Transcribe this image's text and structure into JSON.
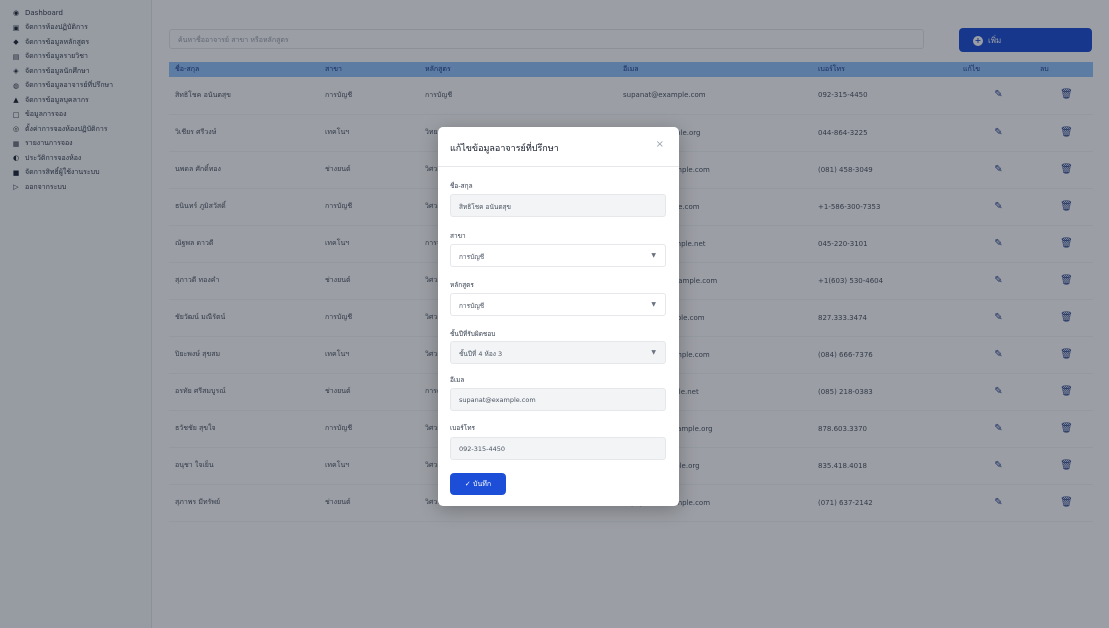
{
  "sidebar": {
    "items": [
      {
        "icon": "dashboard-icon",
        "glyph": "◉",
        "label": "Dashboard"
      },
      {
        "icon": "lab-icon",
        "glyph": "▣",
        "label": "จัดการห้องปฏิบัติการ"
      },
      {
        "icon": "book-icon",
        "glyph": "◆",
        "label": "จัดการข้อมูลหลักสูตร"
      },
      {
        "icon": "clipboard-icon",
        "glyph": "▤",
        "label": "จัดการข้อมูลรายวิชา"
      },
      {
        "icon": "students-icon",
        "glyph": "◈",
        "label": "จัดการข้อมูลนักศึกษา"
      },
      {
        "icon": "user-tie-icon",
        "glyph": "◍",
        "label": "จัดการข้อมูลอาจารย์ที่ปรึกษา"
      },
      {
        "icon": "user-icon",
        "glyph": "▲",
        "label": "จัดการข้อมูลบุคลากร"
      },
      {
        "icon": "calendar-icon",
        "glyph": "□",
        "label": "ข้อมูลการจอง"
      },
      {
        "icon": "settings-icon",
        "glyph": "◎",
        "label": "ตั้งค่าการจองห้องปฏิบัติการ"
      },
      {
        "icon": "report-icon",
        "glyph": "▦",
        "label": "รายงานการจอง"
      },
      {
        "icon": "history-icon",
        "glyph": "◐",
        "label": "ประวัติการจองห้อง"
      },
      {
        "icon": "key-icon",
        "glyph": "■",
        "label": "จัดการสิทธิ์ผู้ใช้งานระบบ"
      },
      {
        "icon": "logout-icon",
        "glyph": "▷",
        "label": "ออกจากระบบ"
      }
    ]
  },
  "toolbar": {
    "search_placeholder": "ค้นหาชื่ออาจารย์ สาขา หรือหลักสูตร",
    "add_label": "เพิ่ม"
  },
  "table": {
    "headers": [
      "ชื่อ-สกุล",
      "สาขา",
      "หลักสูตร",
      "อีเมล",
      "เบอร์โทร",
      "แก้ไข",
      "ลบ"
    ],
    "rows": [
      [
        "สิทธิโชค อนันตสุข",
        "การบัญชี",
        "การบัญชี",
        "supanat@example.com",
        "092-315-4450"
      ],
      [
        "วิเชียร ศรีวงษ์",
        "เทคโนฯ",
        "วิทยาการคอมพิวเตอร์",
        "wichian@example.org",
        "044-864-3225"
      ],
      [
        "นพดล ศักดิ์ทอง",
        "ช่างยนต์",
        "วิศวกรรมยานยนต์",
        "noppadol@example.com",
        "(081) 458-3049"
      ],
      [
        "ธนินทร์ ภูมิสวัสดิ์",
        "การบัญชี",
        "วิศวกรรมซอฟต์แวร์",
        "thanin@example.com",
        "+1-586-300-7353"
      ],
      [
        "ณัฐพล ดาวดี",
        "เทคโนฯ",
        "การจัดการ",
        "nattapon@example.net",
        "045-220-3101"
      ],
      [
        "สุภาวดี ทองคำ",
        "ช่างยนต์",
        "วิศวกรรมไฟฟ้า",
        "supawadee@example.com",
        "+1(603) 530-4604"
      ],
      [
        "ชัยวัฒน์ มณีรัตน์",
        "การบัญชี",
        "วิศวกรรมโยธา",
        "chaiwat@example.com",
        "827.333.3474"
      ],
      [
        "ปิยะพงษ์ สุขสม",
        "เทคโนฯ",
        "วิศวกรรมเครื่องกล",
        "piyapong@example.com",
        "(084) 666-7376"
      ],
      [
        "อรทัย ศรีสมบูรณ์",
        "ช่างยนต์",
        "การตลาด",
        "orathai@example.net",
        "(085) 218-0383"
      ],
      [
        "ธวัชชัย สุขใจ",
        "การบัญชี",
        "วิศวกรรมอุตสาหการ",
        "thawatchai@example.org",
        "878.603.3370"
      ],
      [
        "อนุชา ใจเย็น",
        "เทคโนฯ",
        "วิศวกรรมคอมพิวเตอร์และเครือข่าย",
        "anucha@example.org",
        "835.418.4018"
      ],
      [
        "สุภาพร มีทรัพย์",
        "ช่างยนต์",
        "วิศวกรรมการผลิต",
        "supaporn@example.com",
        "(071) 637-2142"
      ]
    ]
  },
  "modal": {
    "title": "แก้ไขข้อมูลอาจารย์ที่ปรึกษา",
    "close": "×",
    "name_label": "ชื่อ-สกุล",
    "name_value": "สิทธิโชค อนันตสุข",
    "branch_label": "สาขา",
    "branch_value": "การบัญชี",
    "program_label": "หลักสูตร",
    "program_value": "การบัญชี",
    "class_label": "ชั้นปีที่รับผิดชอบ",
    "class_value": "ชั้นปีที่ 4 ห้อง 3",
    "email_label": "อีเมล",
    "email_value": "supanat@example.com",
    "phone_label": "เบอร์โทร",
    "phone_value": "092-315-4450",
    "save_label": "✓ บันทึก"
  },
  "colors": {
    "primary": "#1d4ed8",
    "header": "#93c5fd",
    "overlay": "#111827"
  }
}
